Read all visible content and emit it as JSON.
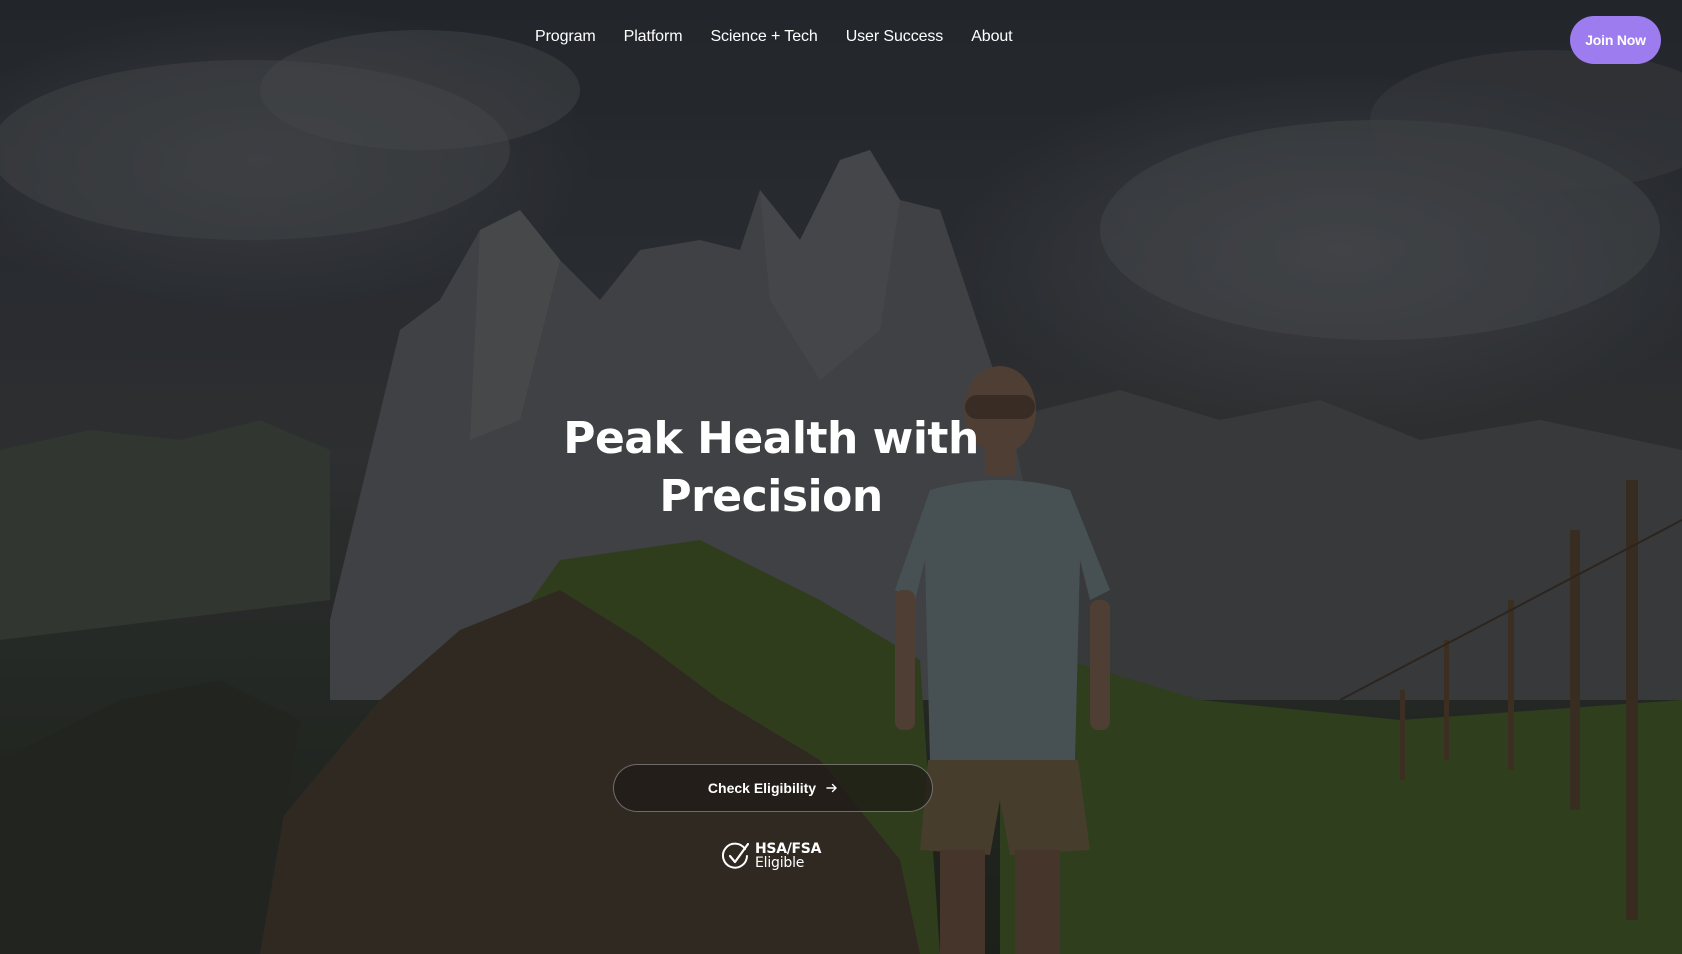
{
  "nav": {
    "links": [
      {
        "label": "Program"
      },
      {
        "label": "Platform"
      },
      {
        "label": "Science + Tech"
      },
      {
        "label": "User Success"
      },
      {
        "label": "About"
      }
    ],
    "cta_label": "Join Now"
  },
  "hero": {
    "headline_line1": "Peak Health with",
    "headline_line2": "Precision",
    "cta_label": "Check Eligibility",
    "cta_icon": "arrow-right-icon",
    "badge_icon": "check-circle-icon",
    "badge_title": "HSA/FSA",
    "badge_subtitle": "Eligible"
  },
  "colors": {
    "accent": "#9d7cf0",
    "text": "#ffffff",
    "cta_background": "#1e1a16"
  }
}
